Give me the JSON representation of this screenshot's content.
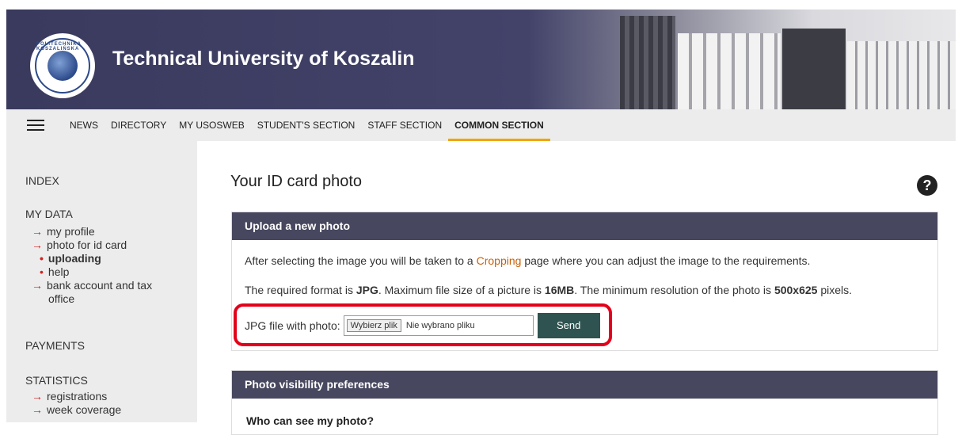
{
  "header": {
    "logo_text": "POLITECHNIKA KOSZALIŃSKA",
    "title": "Technical University of Koszalin"
  },
  "nav": {
    "items": [
      "NEWS",
      "DIRECTORY",
      "MY USOSWEB",
      "STUDENT'S SECTION",
      "STAFF SECTION",
      "COMMON SECTION"
    ],
    "active": "COMMON SECTION"
  },
  "sidebar": {
    "index": "INDEX",
    "my_data": "MY DATA",
    "my_profile": "my profile",
    "photo_for_id": "photo for id card",
    "uploading": "uploading",
    "help": "help",
    "bank_1": "bank account and tax",
    "bank_2": "office",
    "payments": "PAYMENTS",
    "statistics": "STATISTICS",
    "registrations": "registrations",
    "week_coverage": "week coverage"
  },
  "main": {
    "title": "Your ID card photo",
    "help_icon": "?",
    "upload_panel": {
      "heading": "Upload a new photo",
      "p1_before": "After selecting the image you will be taken to a ",
      "p1_link": "Cropping",
      "p1_after": " page where you can adjust the image to the requirements.",
      "p2_a": "The required format is ",
      "p2_b": "JPG",
      "p2_c": ". Maximum file size of a picture is ",
      "p2_d": "16MB",
      "p2_e": ". The minimum resolution of the photo is ",
      "p2_f": "500x625",
      "p2_g": " pixels.",
      "file_label": "JPG file with photo:",
      "choose_button": "Wybierz plik",
      "no_file": "Nie wybrano pliku",
      "send_button": "Send"
    },
    "visibility_panel": {
      "heading": "Photo visibility preferences",
      "question": "Who can see my photo?"
    }
  },
  "colors": {
    "header_bg": "#47475f",
    "accent_orange": "#f0a500",
    "link_orange": "#c8600a",
    "arrow_red": "#d42020",
    "send_green": "#2e5350",
    "highlight_red": "#e3001b"
  }
}
